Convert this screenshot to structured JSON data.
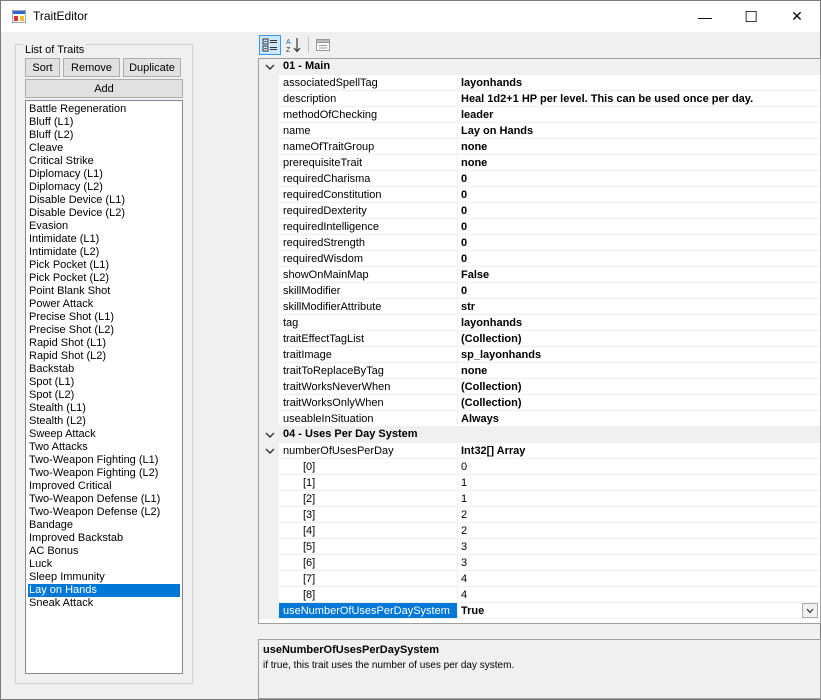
{
  "window": {
    "title": "TraitEditor",
    "minimize": "—",
    "maximize": "☐",
    "close": "✕"
  },
  "left": {
    "group_label": "List of Traits",
    "buttons": {
      "sort": "Sort",
      "remove": "Remove",
      "duplicate": "Duplicate",
      "add": "Add"
    },
    "traits": [
      "Battle Regeneration",
      "Bluff (L1)",
      "Bluff (L2)",
      "Cleave",
      "Critical Strike",
      "Diplomacy (L1)",
      "Diplomacy (L2)",
      "Disable Device (L1)",
      "Disable Device (L2)",
      "Evasion",
      "Intimidate (L1)",
      "Intimidate (L2)",
      "Pick Pocket (L1)",
      "Pick Pocket (L2)",
      "Point Blank Shot",
      "Power Attack",
      "Precise Shot (L1)",
      "Precise Shot (L2)",
      "Rapid Shot (L1)",
      "Rapid Shot (L2)",
      "Backstab",
      "Spot (L1)",
      "Spot (L2)",
      "Stealth (L1)",
      "Stealth (L2)",
      "Sweep Attack",
      "Two Attacks",
      "Two-Weapon Fighting (L1)",
      "Two-Weapon Fighting (L2)",
      "Improved Critical",
      "Two-Weapon Defense (L1)",
      "Two-Weapon Defense (L2)",
      "Bandage",
      "Improved Backstab",
      "AC Bonus",
      "Luck",
      "Sleep Immunity",
      "Lay on Hands",
      "Sneak Attack"
    ],
    "selected_index": 37
  },
  "grid": {
    "cat_main": "01 - Main",
    "main_props": [
      {
        "name": "associatedSpellTag",
        "value": "layonhands"
      },
      {
        "name": "description",
        "value": "Heal 1d2+1 HP per level. This can be used once per day."
      },
      {
        "name": "methodOfChecking",
        "value": "leader"
      },
      {
        "name": "name",
        "value": "Lay on Hands"
      },
      {
        "name": "nameOfTraitGroup",
        "value": "none"
      },
      {
        "name": "prerequisiteTrait",
        "value": "none"
      },
      {
        "name": "requiredCharisma",
        "value": "0"
      },
      {
        "name": "requiredConstitution",
        "value": "0"
      },
      {
        "name": "requiredDexterity",
        "value": "0"
      },
      {
        "name": "requiredIntelligence",
        "value": "0"
      },
      {
        "name": "requiredStrength",
        "value": "0"
      },
      {
        "name": "requiredWisdom",
        "value": "0"
      },
      {
        "name": "showOnMainMap",
        "value": "False"
      },
      {
        "name": "skillModifier",
        "value": "0"
      },
      {
        "name": "skillModifierAttribute",
        "value": "str"
      },
      {
        "name": "tag",
        "value": "layonhands"
      },
      {
        "name": "traitEffectTagList",
        "value": "(Collection)"
      },
      {
        "name": "traitImage",
        "value": "sp_layonhands"
      },
      {
        "name": "traitToReplaceByTag",
        "value": "none"
      },
      {
        "name": "traitWorksNeverWhen",
        "value": "(Collection)"
      },
      {
        "name": "traitWorksOnlyWhen",
        "value": "(Collection)"
      },
      {
        "name": "useableInSituation",
        "value": "Always"
      }
    ],
    "cat_uses": "04 - Uses Per Day System",
    "array_prop": {
      "name": "numberOfUsesPerDay",
      "value": "Int32[] Array"
    },
    "array_items": [
      {
        "name": "[0]",
        "value": "0"
      },
      {
        "name": "[1]",
        "value": "1"
      },
      {
        "name": "[2]",
        "value": "1"
      },
      {
        "name": "[3]",
        "value": "2"
      },
      {
        "name": "[4]",
        "value": "2"
      },
      {
        "name": "[5]",
        "value": "3"
      },
      {
        "name": "[6]",
        "value": "3"
      },
      {
        "name": "[7]",
        "value": "4"
      },
      {
        "name": "[8]",
        "value": "4"
      }
    ],
    "selected_prop": {
      "name": "useNumberOfUsesPerDaySystem",
      "value": "True"
    }
  },
  "help": {
    "title": "useNumberOfUsesPerDaySystem",
    "description": "if true, this trait uses the number of uses per day system."
  },
  "colors": {
    "selection": "#0078d7",
    "window_bg": "#f0f0f0"
  }
}
